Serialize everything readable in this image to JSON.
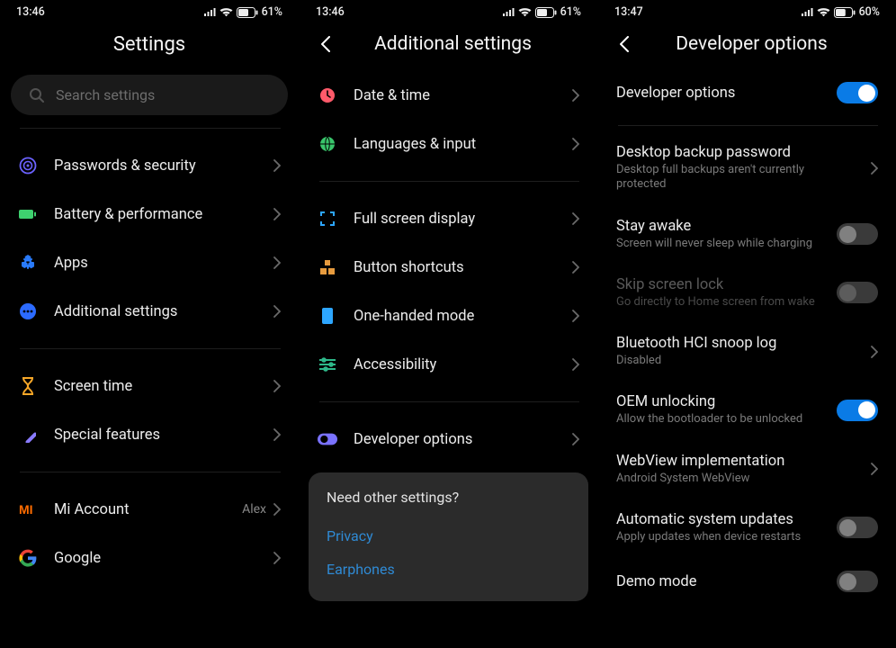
{
  "panel1": {
    "status": {
      "time": "13:46",
      "battery": "61"
    },
    "title": "Settings",
    "search_placeholder": "Search settings",
    "items_a": [
      {
        "label": "Passwords & security"
      },
      {
        "label": "Battery & performance"
      },
      {
        "label": "Apps"
      },
      {
        "label": "Additional settings"
      }
    ],
    "items_b": [
      {
        "label": "Screen time"
      },
      {
        "label": "Special features"
      }
    ],
    "mi_account": {
      "label": "Mi Account",
      "value": "Alex"
    },
    "google": {
      "label": "Google"
    }
  },
  "panel2": {
    "status": {
      "time": "13:46",
      "battery": "61"
    },
    "title": "Additional settings",
    "items_a": [
      {
        "label": "Date & time"
      },
      {
        "label": "Languages & input"
      }
    ],
    "items_b": [
      {
        "label": "Full screen display"
      },
      {
        "label": "Button shortcuts"
      },
      {
        "label": "One-handed mode"
      },
      {
        "label": "Accessibility"
      }
    ],
    "items_c": [
      {
        "label": "Developer options"
      }
    ],
    "card": {
      "title": "Need other settings?",
      "links": [
        "Privacy",
        "Earphones"
      ]
    }
  },
  "panel3": {
    "status": {
      "time": "13:47",
      "battery": "60"
    },
    "title": "Developer options",
    "main_toggle": {
      "label": "Developer options",
      "on": true
    },
    "rows": [
      {
        "label": "Desktop backup password",
        "sub": "Desktop full backups aren't currently protected",
        "type": "chevron"
      },
      {
        "label": "Stay awake",
        "sub": "Screen will never sleep while charging",
        "type": "toggle",
        "on": false
      },
      {
        "label": "Skip screen lock",
        "sub": "Go directly to Home screen from wake",
        "type": "toggle",
        "on": false,
        "disabled": true
      },
      {
        "label": "Bluetooth HCI snoop log",
        "sub": "Disabled",
        "type": "chevron"
      },
      {
        "label": "OEM unlocking",
        "sub": "Allow the bootloader to be unlocked",
        "type": "toggle",
        "on": true
      },
      {
        "label": "WebView implementation",
        "sub": "Android System WebView",
        "type": "chevron"
      },
      {
        "label": "Automatic system updates",
        "sub": "Apply updates when device restarts",
        "type": "toggle",
        "on": false
      },
      {
        "label": "Demo mode",
        "type": "toggle",
        "on": false
      }
    ]
  },
  "percent_sign": "%"
}
